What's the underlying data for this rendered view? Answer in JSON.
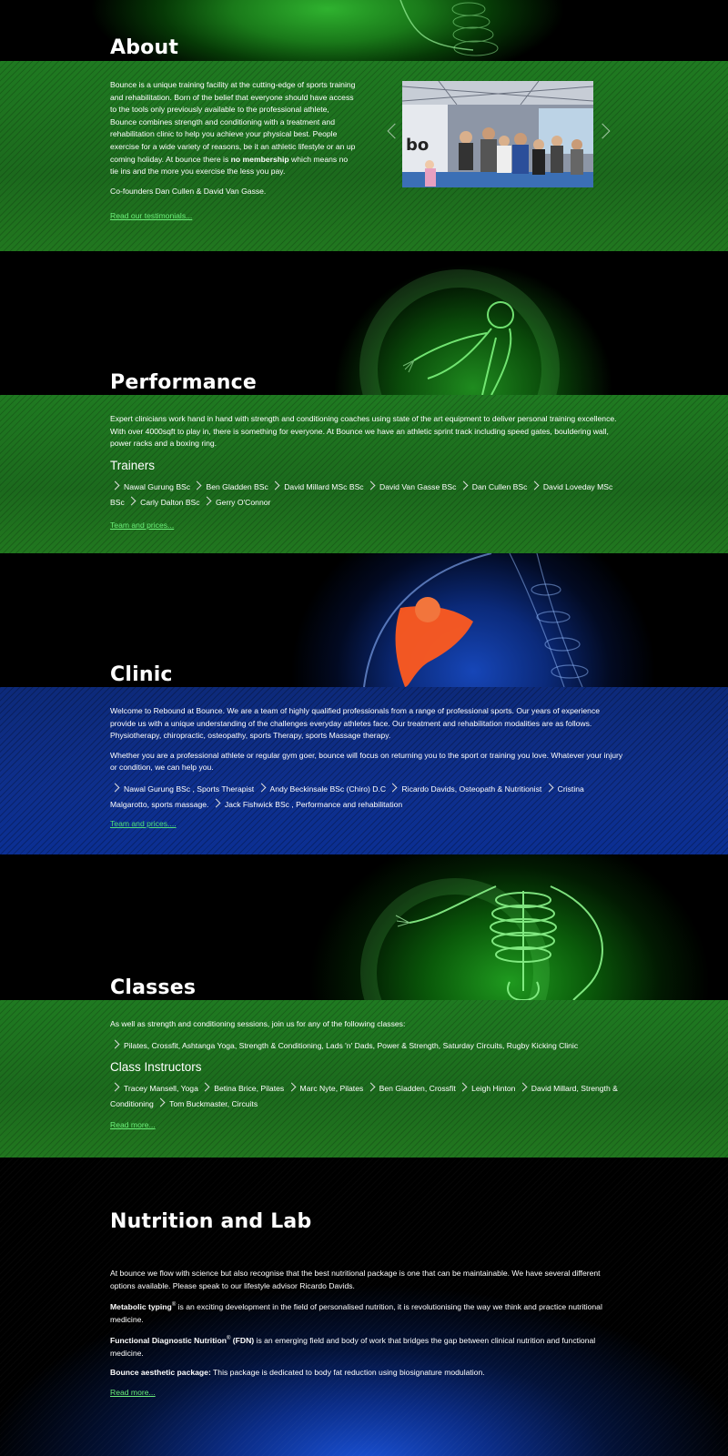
{
  "about": {
    "title": "About",
    "body_start": "Bounce is a unique training facility at the cutting-edge of sports training and rehabilitation. Born of the belief that everyone should have access to the tools only previously available to the professional athlete, Bounce combines strength and conditioning with a treatment and rehabilitation clinic to help you achieve your physical best. People exercise for a wide variety of reasons, be it an athletic lifestyle or an up coming holiday. At bounce there is ",
    "body_bold": "no membership",
    "body_end": " which means no tie ins and the more you exercise the less you pay.",
    "founders": "Co-founders Dan Cullen & David Van Gasse.",
    "link": "Read our testimonials..."
  },
  "performance": {
    "title": "Performance",
    "body": "Expert clinicians work hand in hand with strength and conditioning coaches using state of the art equipment to deliver personal training excellence. With over 4000sqft to play in, there is something for everyone. At Bounce we have an athletic sprint track including speed gates, bouldering wall, power racks and a boxing ring.",
    "subhead": "Trainers",
    "trainers": [
      "Nawal Gurung BSc",
      "Ben Gladden BSc",
      "David Millard MSc BSc",
      "David Van Gasse BSc",
      "Dan Cullen BSc",
      "David Loveday MSc BSc",
      "Carly Dalton BSc",
      "Gerry O'Connor"
    ],
    "link": "Team and prices..."
  },
  "clinic": {
    "title": "Clinic",
    "body1": "Welcome to Rebound at Bounce. We are a team of highly qualified professionals from a range of professional sports. Our years of experience provide us with a unique understanding of the challenges everyday athletes face. Our treatment and rehabilitation modalities are as follows. Physiotherapy, chiropractic, osteopathy, sports Therapy, sports Massage therapy.",
    "body2": "Whether you are a professional athlete or regular gym goer, bounce will focus on returning you to the sport or training you love. Whatever your injury or condition, we can help you.",
    "staff": [
      "Nawal Gurung BSc , Sports Therapist",
      "Andy Beckinsale BSc (Chiro) D.C",
      "Ricardo Davids, Osteopath & Nutritionist",
      "Cristina Malgarotto, sports massage.",
      "Jack Fishwick BSc , Performance and rehabilitation"
    ],
    "link": "Team and prices...."
  },
  "classes": {
    "title": "Classes",
    "intro": "As well as strength and conditioning sessions, join us for any of the following classes:",
    "classes_list": [
      "Pilates, Crossfit, Ashtanga Yoga, Strength & Conditioning, Lads 'n' Dads, Power & Strength, Saturday Circuits, Rugby Kicking Clinic"
    ],
    "subhead": "Class Instructors",
    "instructors": [
      "Tracey Mansell, Yoga",
      "Betina Brice, Pilates",
      "Marc Nyte, Pilates",
      "Ben Gladden, Crossfit",
      "Leigh Hinton",
      "David Millard, Strength & Conditioning",
      "Tom Buckmaster, Circuits"
    ],
    "link": "Read more..."
  },
  "nutrition": {
    "title": "Nutrition and Lab",
    "intro": "At bounce we flow with science but also recognise that the best nutritional package is one that can be maintainable. We have several different options available. Please speak to our lifestyle advisor Ricardo Davids.",
    "item1_bold": "Metabolic typing",
    "item1_sup": "®",
    "item1_text": " is an exciting development in the field of personalised nutrition, it is revolutionising the way we think and practice nutritional medicine.",
    "item2_bold": "Functional Diagnostic Nutrition",
    "item2_sup": "®",
    "item2_bold2": " (FDN)",
    "item2_text": " is an emerging field and body of work that bridges the gap between clinical nutrition and functional medicine.",
    "item3_bold": "Bounce aesthetic package:",
    "item3_text": " This package is dedicated to body fat reduction using biosignature modulation.",
    "link": "Read more..."
  },
  "colors": {
    "green": "#1f7a21",
    "blue": "#0e2f8c",
    "link": "#6cf07a"
  }
}
